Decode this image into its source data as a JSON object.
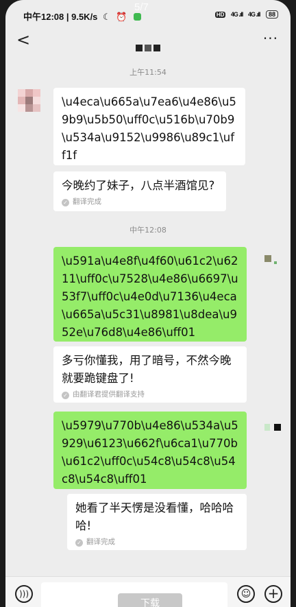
{
  "status": {
    "time_speed": "中午12:08 | 9.5K/s",
    "page_indicator": "5/7",
    "hd": "HD",
    "signal1": "4G .ıll",
    "signal2": "4G .ıll",
    "battery": "88"
  },
  "nav": {
    "back": "<",
    "more": "···"
  },
  "timestamps": [
    "上午11:54",
    "中午12:08"
  ],
  "messages": [
    {
      "side": "left",
      "text": "\\u4eca\\u665a\\u7ea6\\u4e86\\u59b9\\u5b50\\uff0c\\u516b\\u70b9\\u534a\\u9152\\u9986\\u89c1\\uff1f"
    },
    {
      "side": "left-translation",
      "text": "今晚约了妹子，八点半酒馆见?",
      "note": "翻译完成"
    },
    {
      "side": "right",
      "text": "\\u591a\\u4e8f\\u4f60\\u61c2\\u6211\\uff0c\\u7528\\u4e86\\u6697\\u53f7\\uff0c\\u4e0d\\u7136\\u4eca\\u665a\\u5c31\\u8981\\u8dea\\u952e\\u76d8\\u4e86\\uff01"
    },
    {
      "side": "right-translation",
      "text": "多亏你懂我，用了暗号，不然今晚就要跪键盘了!",
      "note": "由翻译君提供翻译支持"
    },
    {
      "side": "right",
      "text": "\\u5979\\u770b\\u4e86\\u534a\\u5929\\u6123\\u662f\\u6ca1\\u770b\\u61c2\\uff0c\\u54c8\\u54c8\\u54c8\\u54c8\\uff01"
    },
    {
      "side": "right-translation",
      "text": "她看了半天愣是没看懂，哈哈哈哈!",
      "note": "翻译完成"
    }
  ],
  "bottom": {
    "download_label": "下载"
  },
  "icons": {
    "voice": "voice-icon",
    "emoji": "emoji-icon",
    "plus": "plus-icon",
    "check": "check-icon"
  },
  "colors": {
    "bubble_green": "#95ec69",
    "bubble_white": "#ffffff",
    "bg": "#ededed"
  }
}
